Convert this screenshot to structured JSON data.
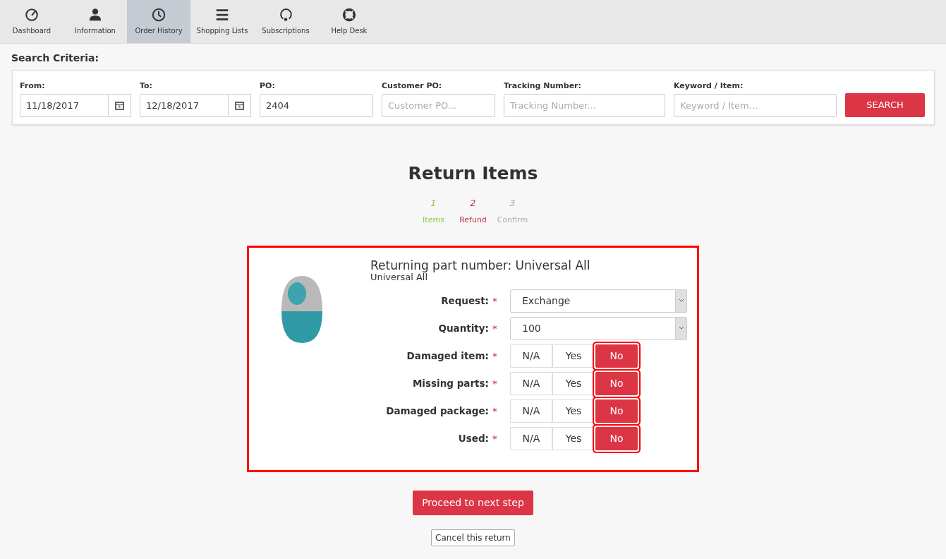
{
  "nav": [
    {
      "label": "Dashboard",
      "selected": false
    },
    {
      "label": "Information",
      "selected": false
    },
    {
      "label": "Order History",
      "selected": true
    },
    {
      "label": "Shopping Lists",
      "selected": false
    },
    {
      "label": "Subscriptions",
      "selected": false
    },
    {
      "label": "Help Desk",
      "selected": false
    }
  ],
  "search": {
    "title": "Search Criteria:",
    "fields": [
      {
        "label": "From:",
        "kind": "date",
        "value": "11/18/2017"
      },
      {
        "label": "To:",
        "kind": "date",
        "value": "12/18/2017"
      },
      {
        "label": "PO:",
        "kind": "text",
        "value": "2404"
      },
      {
        "label": "Customer PO:",
        "kind": "text",
        "placeholder": "Customer PO..."
      },
      {
        "label": "Tracking Number:",
        "kind": "text",
        "placeholder": "Tracking Number..."
      },
      {
        "label": "Keyword / Item:",
        "kind": "text",
        "placeholder": "Keyword / Item..."
      }
    ],
    "button": "SEARCH"
  },
  "return": {
    "title": "Return Items",
    "steps": [
      {
        "number": "1",
        "label": "Items",
        "color": "#8cc63f"
      },
      {
        "number": "2",
        "label": "Refund",
        "color": "#c0313e"
      },
      {
        "number": "3",
        "label": "Confirm",
        "color": "#aaaaaa"
      }
    ],
    "part": {
      "title": "Returning part number: Universal All",
      "subtitle": "Universal All"
    },
    "selects": [
      {
        "label": "Request:",
        "required": "*",
        "value": "Exchange"
      },
      {
        "label": "Quantity:",
        "required": "*",
        "value": "100"
      }
    ],
    "toggles": [
      {
        "label": "Damaged item:",
        "required": "*",
        "options": [
          {
            "label": "N/A",
            "selected": false
          },
          {
            "label": "Yes",
            "selected": false
          },
          {
            "label": "No",
            "selected": true
          }
        ]
      },
      {
        "label": "Missing parts:",
        "required": "*",
        "options": [
          {
            "label": "N/A",
            "selected": false
          },
          {
            "label": "Yes",
            "selected": false
          },
          {
            "label": "No",
            "selected": true
          }
        ]
      },
      {
        "label": "Damaged package:",
        "required": "*",
        "options": [
          {
            "label": "N/A",
            "selected": false
          },
          {
            "label": "Yes",
            "selected": false
          },
          {
            "label": "No",
            "selected": true
          }
        ]
      },
      {
        "label": "Used:",
        "required": "*",
        "options": [
          {
            "label": "N/A",
            "selected": false
          },
          {
            "label": "Yes",
            "selected": false
          },
          {
            "label": "No",
            "selected": true
          }
        ]
      }
    ],
    "proceed": "Proceed to next step",
    "cancel": "Cancel this return"
  }
}
